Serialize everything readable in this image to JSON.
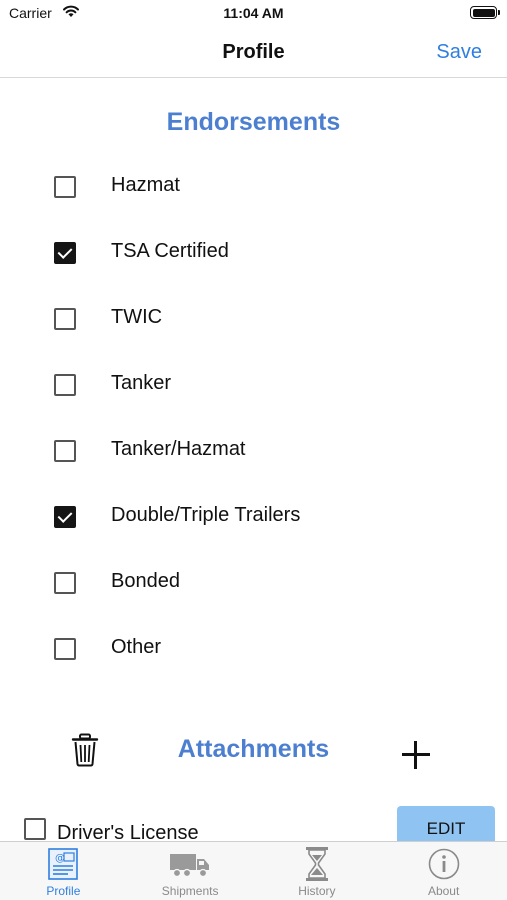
{
  "status_bar": {
    "carrier": "Carrier",
    "time": "11:04 AM"
  },
  "nav": {
    "title": "Profile",
    "save_label": "Save"
  },
  "endorsements": {
    "title": "Endorsements",
    "items": [
      {
        "label": "Hazmat",
        "checked": false
      },
      {
        "label": "TSA Certified",
        "checked": true
      },
      {
        "label": "TWIC",
        "checked": false
      },
      {
        "label": "Tanker",
        "checked": false
      },
      {
        "label": "Tanker/Hazmat",
        "checked": false
      },
      {
        "label": "Double/Triple Trailers",
        "checked": true
      },
      {
        "label": "Bonded",
        "checked": false
      },
      {
        "label": "Other",
        "checked": false
      }
    ]
  },
  "attachments": {
    "title": "Attachments",
    "items": [
      {
        "label": "Driver's License",
        "checked": false,
        "edit_label": "EDIT"
      }
    ]
  },
  "tabs": [
    {
      "label": "Profile",
      "icon": "profile-card-icon",
      "active": true
    },
    {
      "label": "Shipments",
      "icon": "truck-icon",
      "active": false
    },
    {
      "label": "History",
      "icon": "hourglass-icon",
      "active": false
    },
    {
      "label": "About",
      "icon": "info-icon",
      "active": false
    }
  ],
  "colors": {
    "accent": "#2f7fe0",
    "section_title": "#4d7fd0",
    "edit_button": "#8ec3f2"
  }
}
